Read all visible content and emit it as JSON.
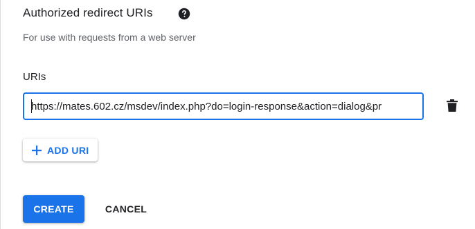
{
  "section": {
    "title": "Authorized redirect URIs",
    "subtitle": "For use with requests from a web server"
  },
  "uris": {
    "label": "URIs",
    "items": [
      {
        "value": "https://mates.602.cz/msdev/index.php?do=login-response&action=dialog&pr"
      }
    ]
  },
  "buttons": {
    "add_uri": "ADD URI",
    "create": "CREATE",
    "cancel": "CANCEL"
  },
  "icons": {
    "help": "help-circle-icon",
    "delete": "trash-icon",
    "add": "plus-icon"
  },
  "colors": {
    "accent": "#1a73e8",
    "text": "#202124",
    "muted": "#5f6368"
  }
}
